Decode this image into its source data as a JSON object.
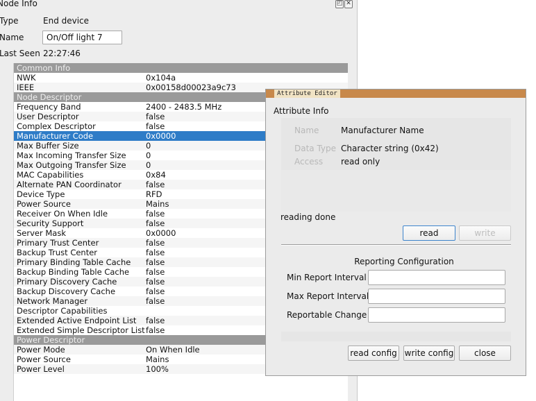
{
  "window": {
    "title": "Node Info"
  },
  "node": {
    "type_label": "Type",
    "type_value": "End device",
    "name_label": "Name",
    "name_value": "On/Off light 7",
    "last_seen_label": "Last Seen",
    "last_seen_value": "22:27:46"
  },
  "tree": [
    {
      "kind": "section",
      "key": "Common Info",
      "value": ""
    },
    {
      "kind": "row",
      "key": "NWK",
      "value": "0x104a"
    },
    {
      "kind": "row",
      "key": "IEEE",
      "value": "0x00158d00023a9c73"
    },
    {
      "kind": "section",
      "key": "Node Descriptor",
      "value": ""
    },
    {
      "kind": "row",
      "key": "Frequency Band",
      "value": "2400 - 2483.5 MHz"
    },
    {
      "kind": "row",
      "key": "User Descriptor",
      "value": "false"
    },
    {
      "kind": "row",
      "key": "Complex Descriptor",
      "value": "false"
    },
    {
      "kind": "selected",
      "key": "Manufacturer Code",
      "value": "0x0000"
    },
    {
      "kind": "row",
      "key": "Max Buffer Size",
      "value": "0"
    },
    {
      "kind": "row",
      "key": "Max Incoming Transfer Size",
      "value": "0"
    },
    {
      "kind": "row",
      "key": "Max Outgoing Transfer Size",
      "value": "0"
    },
    {
      "kind": "row",
      "key": "MAC Capabilities",
      "value": "0x84"
    },
    {
      "kind": "row",
      "key": "Alternate PAN Coordinator",
      "value": "false"
    },
    {
      "kind": "row",
      "key": "Device Type",
      "value": "RFD"
    },
    {
      "kind": "row",
      "key": "Power Source",
      "value": "Mains"
    },
    {
      "kind": "row",
      "key": "Receiver On When Idle",
      "value": "false"
    },
    {
      "kind": "row",
      "key": "Security Support",
      "value": "false"
    },
    {
      "kind": "row",
      "key": "Server Mask",
      "value": "0x0000"
    },
    {
      "kind": "row",
      "key": "Primary Trust Center",
      "value": "false"
    },
    {
      "kind": "row",
      "key": "Backup Trust Center",
      "value": "false"
    },
    {
      "kind": "row",
      "key": "Primary Binding Table Cache",
      "value": "false"
    },
    {
      "kind": "row",
      "key": "Backup Binding Table Cache",
      "value": "false"
    },
    {
      "kind": "row",
      "key": "Primary Discovery Cache",
      "value": "false"
    },
    {
      "kind": "row",
      "key": "Backup Discovery Cache",
      "value": "false"
    },
    {
      "kind": "row",
      "key": "Network Manager",
      "value": "false"
    },
    {
      "kind": "row",
      "key": "Descriptor Capabilities",
      "value": ""
    },
    {
      "kind": "row",
      "key": "Extended Active Endpoint List",
      "value": "false"
    },
    {
      "kind": "row",
      "key": "Extended Simple Descriptor List",
      "value": "false"
    },
    {
      "kind": "section",
      "key": "Power Descriptor",
      "value": ""
    },
    {
      "kind": "row",
      "key": "Power Mode",
      "value": "On When Idle"
    },
    {
      "kind": "row",
      "key": "Power Source",
      "value": "Mains"
    },
    {
      "kind": "row",
      "key": "Power Level",
      "value": "100%"
    }
  ],
  "attr_editor": {
    "title": "Attribute Editor",
    "header": "Attribute Info",
    "name_label": "Name",
    "name_value": "Manufacturer Name",
    "data_type_label": "Data Type",
    "data_type_value": "Character string (0x42)",
    "access_label": "Access",
    "access_value": "read only",
    "status": "reading done",
    "read_label": "read",
    "write_label": "write",
    "reporting_title": "Reporting Configuration",
    "min_label": "Min Report Interval",
    "max_label": "Max Report Interval",
    "change_label": "Reportable Change",
    "read_config_label": "read config",
    "write_config_label": "write config",
    "close_label": "close"
  }
}
